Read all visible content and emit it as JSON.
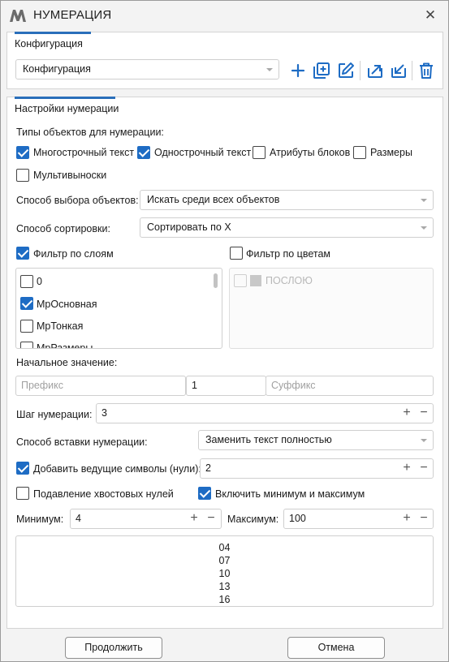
{
  "window": {
    "title": "НУМЕРАЦИЯ",
    "accent": "#1e6cc4"
  },
  "config": {
    "tab_label": "Конфигурация",
    "combo_value": "Конфигурация",
    "toolbar": [
      "plus-icon",
      "add-square-icon",
      "edit-icon",
      "export-icon",
      "import-icon",
      "trash-icon"
    ]
  },
  "settings": {
    "tab_label": "Настройки нумерации",
    "object_types_label": "Типы объектов для нумерации:",
    "object_types": [
      {
        "label": "Многострочный текст",
        "checked": true
      },
      {
        "label": "Однострочный текст",
        "checked": true
      },
      {
        "label": "Атрибуты блоков",
        "checked": false
      },
      {
        "label": "Размеры",
        "checked": false
      },
      {
        "label": "Мультивыноски",
        "checked": false
      }
    ],
    "selection_label": "Способ выбора объектов:",
    "selection_value": "Искать среди всех объектов",
    "sort_label": "Способ сортировки:",
    "sort_value": "Сортировать по X",
    "layer_filter": {
      "label": "Фильтр по слоям",
      "checked": true
    },
    "color_filter": {
      "label": "Фильтр по цветам",
      "checked": false
    },
    "layers": [
      {
        "label": "0",
        "checked": false
      },
      {
        "label": "МрОсновная",
        "checked": true
      },
      {
        "label": "МрТонкая",
        "checked": false
      },
      {
        "label": "МрРазмеры",
        "checked": false
      }
    ],
    "colors": [
      {
        "label": "ПОСЛОЮ",
        "checked": false
      }
    ],
    "start_label": "Начальное значение:",
    "prefix_placeholder": "Префикс",
    "start_value": "1",
    "suffix_placeholder": "Суффикс",
    "step_label": "Шаг нумерации:",
    "step_value": "3",
    "insert_label": "Способ вставки нумерации:",
    "insert_value": "Заменить текст полностью",
    "leading": {
      "label": "Добавить ведущие символы (нули):",
      "checked": true,
      "value": "2"
    },
    "trailing": {
      "label": "Подавление хвостовых нулей",
      "checked": false
    },
    "minmax": {
      "label": "Включить минимум и максимум",
      "checked": true
    },
    "min_label": "Минимум:",
    "min_value": "4",
    "max_label": "Максимум:",
    "max_value": "100",
    "preview": [
      "04",
      "07",
      "10",
      "13",
      "16"
    ]
  },
  "buttons": {
    "continue": "Продолжить",
    "cancel": "Отмена"
  },
  "step_plus": "+",
  "step_minus": "−"
}
